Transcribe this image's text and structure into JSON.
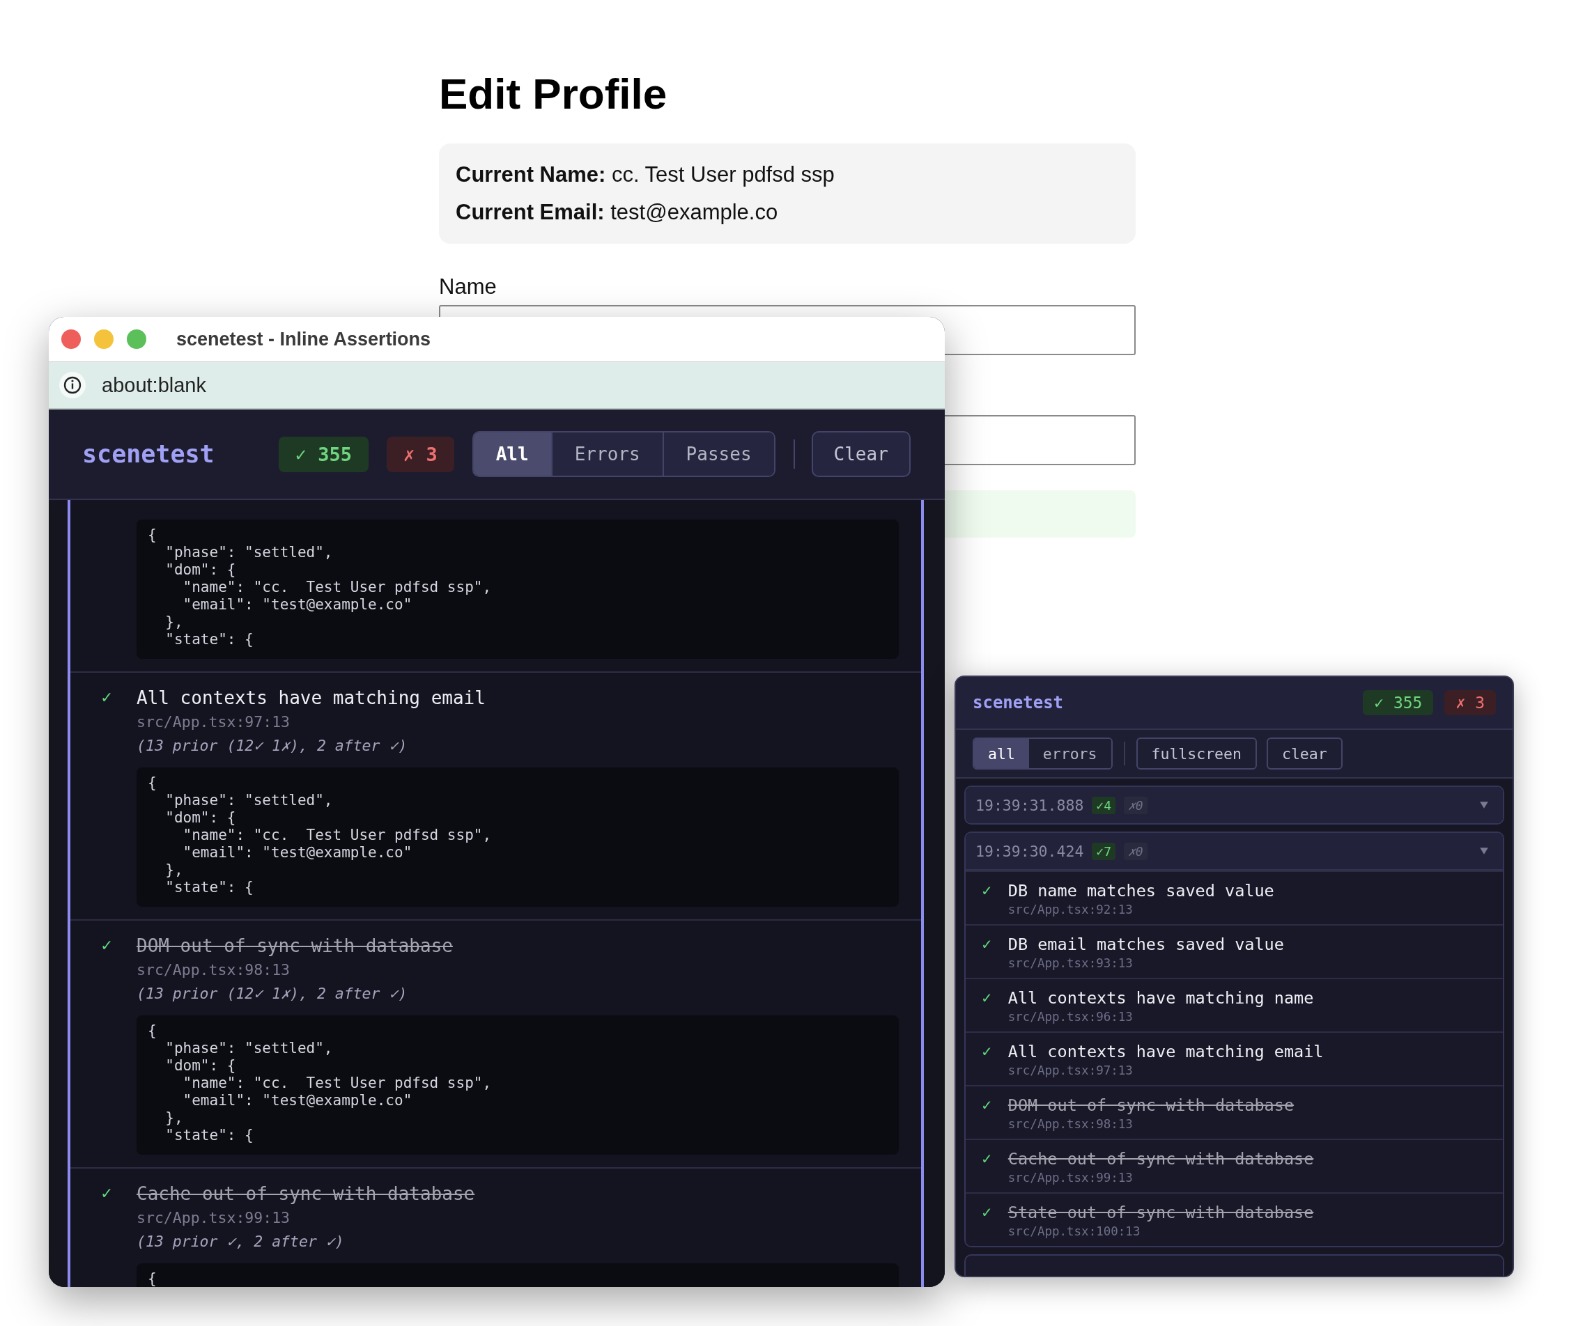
{
  "page": {
    "title": "Edit Profile",
    "info": [
      {
        "label": "Current Name:",
        "value": "cc. Test User pdfsd ssp"
      },
      {
        "label": "Current Email:",
        "value": "test@example.co"
      }
    ],
    "fields": [
      {
        "kind": "text",
        "label": "Name"
      },
      {
        "kind": "text"
      }
    ],
    "notice": {
      "kind": "success"
    }
  },
  "window": {
    "title": "scenetest - Inline Assertions",
    "address": "about:blank",
    "brand": "scenetest",
    "passed": "✓ 355",
    "failed": "✗ 3",
    "tabs": [
      {
        "label": "All",
        "selected": true
      },
      {
        "label": "Errors",
        "selected": false
      },
      {
        "label": "Passes",
        "selected": false
      }
    ],
    "clear": "Clear",
    "entries": [
      {
        "code": [
          "{",
          "  \"phase\": \"settled\",",
          "  \"dom\": {",
          "    \"name\": \"cc.  Test User pdfsd ssp\",",
          "    \"email\": \"test@example.co\"",
          "  },",
          "  \"state\": {"
        ]
      },
      {
        "kind": "pass",
        "mark": "✓",
        "struck": false,
        "title": "All contexts have matching email",
        "location": "src/App.tsx:97:13",
        "history": "(13 prior (12✓ 1✗), 2 after ✓)",
        "code": [
          "{",
          "  \"phase\": \"settled\",",
          "  \"dom\": {",
          "    \"name\": \"cc.  Test User pdfsd ssp\",",
          "    \"email\": \"test@example.co\"",
          "  },",
          "  \"state\": {"
        ]
      },
      {
        "kind": "pass",
        "mark": "✓",
        "struck": true,
        "title": "DOM out of sync with database",
        "location": "src/App.tsx:98:13",
        "history": "(13 prior (12✓ 1✗), 2 after ✓)",
        "code": [
          "{",
          "  \"phase\": \"settled\",",
          "  \"dom\": {",
          "    \"name\": \"cc.  Test User pdfsd ssp\",",
          "    \"email\": \"test@example.co\"",
          "  },",
          "  \"state\": {"
        ]
      },
      {
        "kind": "pass",
        "mark": "✓",
        "struck": true,
        "title": "Cache out of sync with database",
        "location": "src/App.tsx:99:13",
        "history": "(13 prior ✓, 2 after ✓)",
        "code": [
          "{"
        ]
      }
    ]
  },
  "panel": {
    "brand": "scenetest",
    "passed": "✓ 355",
    "failed": "✗ 3",
    "tabs": [
      {
        "label": "all",
        "selected": true
      },
      {
        "label": "errors",
        "selected": false
      }
    ],
    "buttons": [
      "fullscreen",
      "clear"
    ],
    "groups": [
      {
        "time": "19:39:31.888",
        "passed": "✓4",
        "failed": "✗0",
        "expanded": false
      },
      {
        "time": "19:39:30.424",
        "passed": "✓7",
        "failed": "✗0",
        "expanded": true,
        "items": [
          {
            "kind": "pass",
            "mark": "✓",
            "struck": false,
            "title": "DB name matches saved value",
            "location": "src/App.tsx:92:13"
          },
          {
            "kind": "pass",
            "mark": "✓",
            "struck": false,
            "title": "DB email matches saved value",
            "location": "src/App.tsx:93:13"
          },
          {
            "kind": "pass",
            "mark": "✓",
            "struck": false,
            "title": "All contexts have matching name",
            "location": "src/App.tsx:96:13"
          },
          {
            "kind": "pass",
            "mark": "✓",
            "struck": false,
            "title": "All contexts have matching email",
            "location": "src/App.tsx:97:13"
          },
          {
            "kind": "pass",
            "mark": "✓",
            "struck": true,
            "title": "DOM out of sync with database",
            "location": "src/App.tsx:98:13"
          },
          {
            "kind": "pass",
            "mark": "✓",
            "struck": true,
            "title": "Cache out of sync with database",
            "location": "src/App.tsx:99:13"
          },
          {
            "kind": "pass",
            "mark": "✓",
            "struck": true,
            "title": "State out of sync with database",
            "location": "src/App.tsx:100:13"
          }
        ]
      }
    ]
  }
}
